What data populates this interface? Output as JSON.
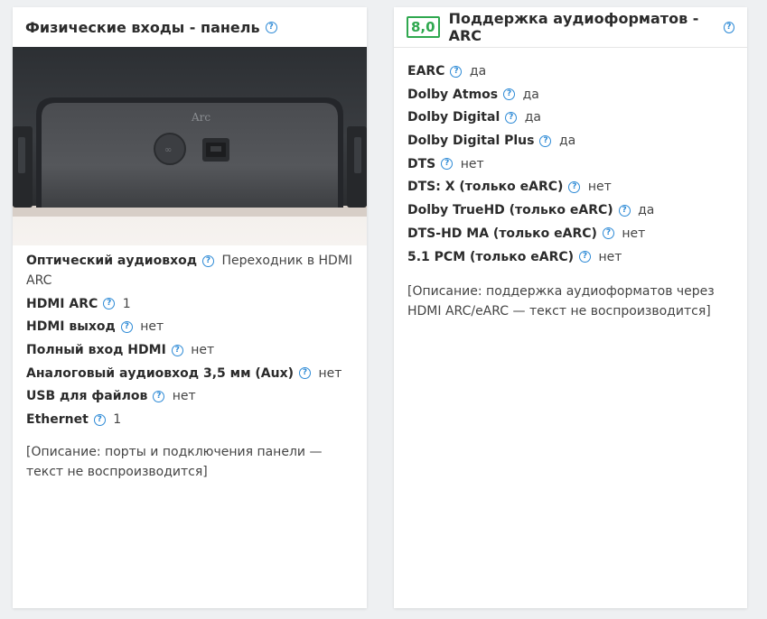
{
  "left_panel": {
    "title": "Физические входы - панель",
    "photo": {
      "label": "Arc",
      "description": "rear connector panel with optical/HDMI port and Ethernet port"
    },
    "specs": [
      {
        "label": "Оптический аудиовход",
        "value": "Переходник в HDMI ARC"
      },
      {
        "label": "HDMI ARC",
        "value": "1"
      },
      {
        "label": "HDMI выход",
        "value": "нет"
      },
      {
        "label": "Полный вход HDMI",
        "value": "нет"
      },
      {
        "label": "Аналоговый аудиовход 3,5 мм (Aux)",
        "value": "нет"
      },
      {
        "label": "USB для файлов",
        "value": "нет"
      },
      {
        "label": "Ethernet",
        "value": "1"
      }
    ],
    "description": "[Описание: порты и подключения панели — текст не воспроизводится]"
  },
  "right_panel": {
    "score": "8,0",
    "title": "Поддержка аудиоформатов - ARC",
    "specs": [
      {
        "label": "EARC",
        "value": "да"
      },
      {
        "label": "Dolby Atmos",
        "value": "да"
      },
      {
        "label": "Dolby Digital",
        "value": "да"
      },
      {
        "label": "Dolby Digital Plus",
        "value": "да"
      },
      {
        "label": "DTS",
        "value": "нет"
      },
      {
        "label": "DTS: X (только eARC)",
        "value": "нет"
      },
      {
        "label": "Dolby TrueHD (только eARC)",
        "value": "да"
      },
      {
        "label": "DTS-HD MA (только eARC)",
        "value": "нет"
      },
      {
        "label": "5.1 PCM (только eARC)",
        "value": "нет"
      }
    ],
    "description": "[Описание: поддержка аудиоформатов через HDMI ARC/eARC — текст не воспроизводится]"
  },
  "colors": {
    "accent": "#2d8ad6",
    "score": "#2fa84f",
    "background": "#eef0f2",
    "card": "#ffffff"
  },
  "icons": {
    "help": "question-circle-icon"
  }
}
